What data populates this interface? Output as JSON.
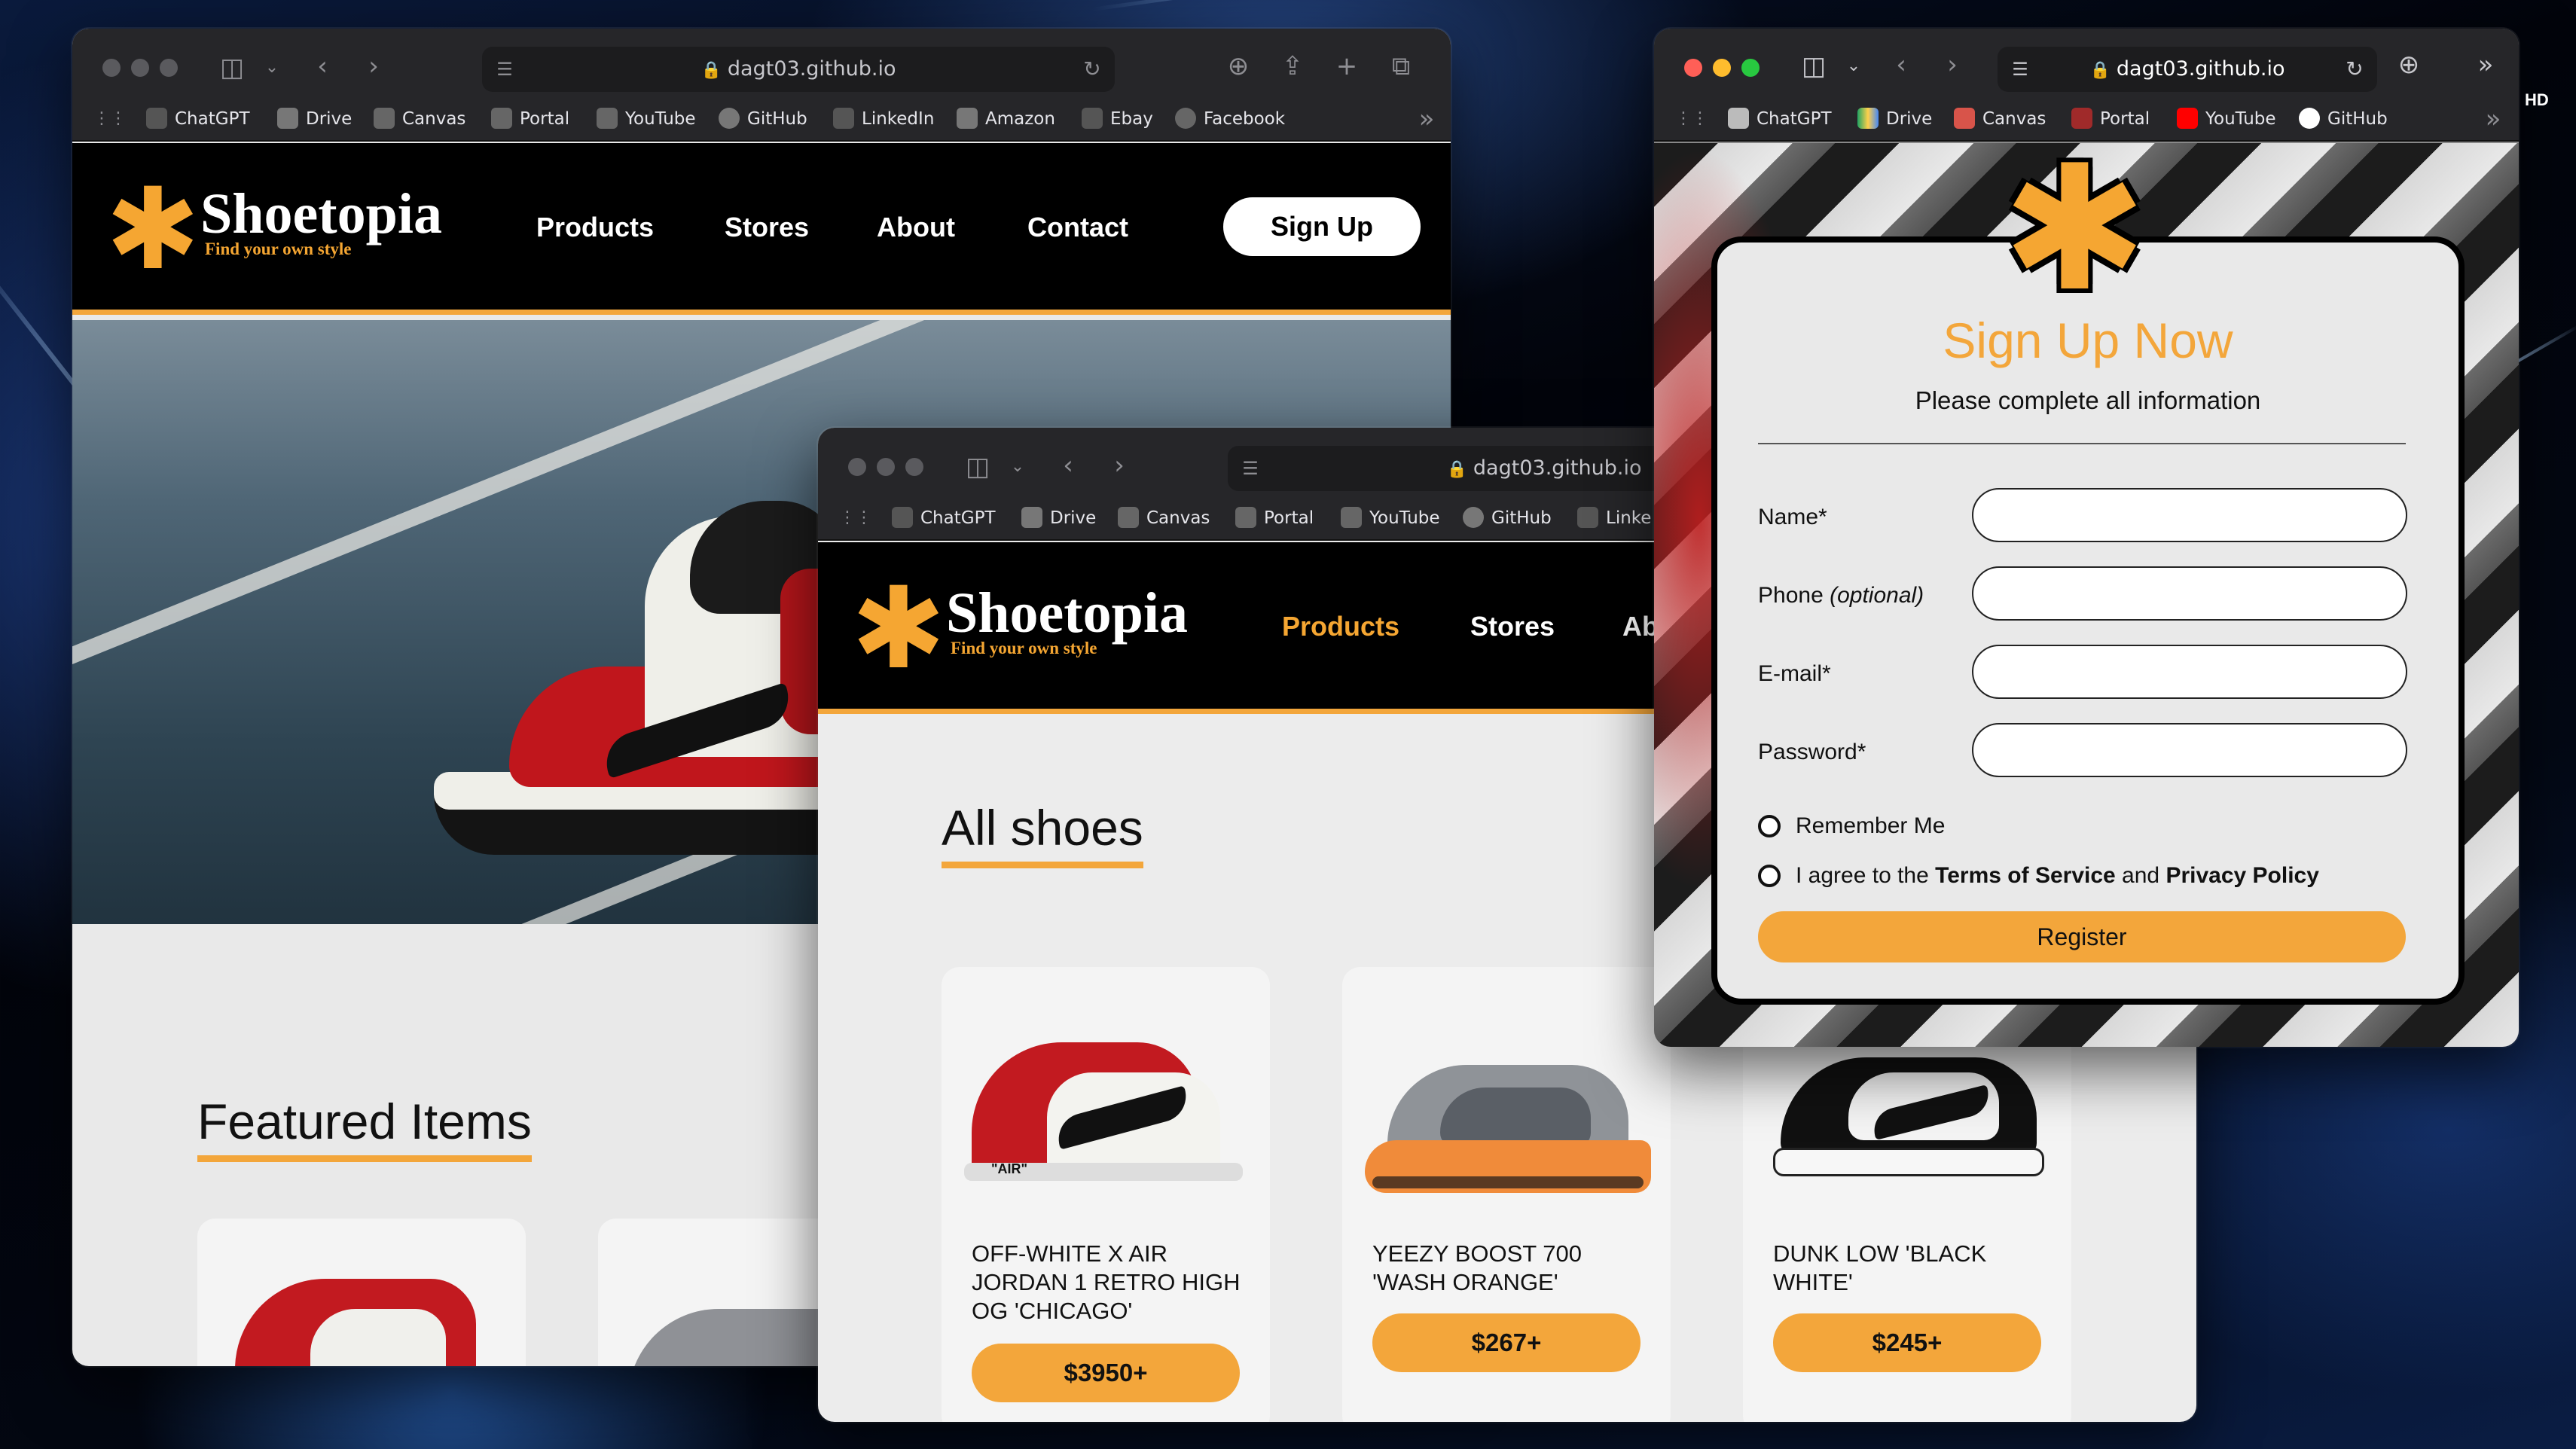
{
  "browser": {
    "url_text": "dagt03.github.io",
    "bookmarks_back": [
      "ChatGPT",
      "Drive",
      "Canvas",
      "Portal",
      "YouTube",
      "GitHub",
      "LinkedIn",
      "Amazon",
      "Ebay",
      "Facebook"
    ],
    "bookmarks_middle": [
      "ChatGPT",
      "Drive",
      "Canvas",
      "Portal",
      "YouTube",
      "GitHub",
      "Linke"
    ],
    "bookmarks_right": [
      "ChatGPT",
      "Drive",
      "Canvas",
      "Portal",
      "YouTube",
      "GitHub"
    ],
    "more_label": "»",
    "edge_text": "HD"
  },
  "site": {
    "brand": "Shoetopia",
    "tagline": "Find your own style",
    "nav": [
      "Products",
      "Stores",
      "About",
      "Contact"
    ],
    "nav_cut_label": "Ab",
    "signup_label": "Sign Up",
    "accent_color": "#f3a63b"
  },
  "home": {
    "featured_title": "Featured Items"
  },
  "products_page": {
    "title": "All shoes",
    "products": [
      {
        "name": "OFF-WHITE X AIR JORDAN 1 RETRO HIGH OG 'CHICAGO'",
        "price": "$3950+",
        "badge": "\"AIR\""
      },
      {
        "name": "YEEZY BOOST 700 'WASH ORANGE'",
        "price": "$267+"
      },
      {
        "name": "DUNK LOW 'BLACK WHITE'",
        "price": "$245+"
      }
    ]
  },
  "signup_form": {
    "title": "Sign Up Now",
    "subtitle": "Please complete all information",
    "fields": [
      {
        "label": "Name*"
      },
      {
        "label": "Phone ",
        "label_em": "(optional)"
      },
      {
        "label": "E-mail*"
      },
      {
        "label": "Password*"
      }
    ],
    "remember_label": "Remember Me",
    "agree_prefix": "I agree to the ",
    "terms_label": "Terms of Service",
    "agree_and": " and ",
    "privacy_label": "Privacy Policy",
    "register_label": "Register"
  }
}
